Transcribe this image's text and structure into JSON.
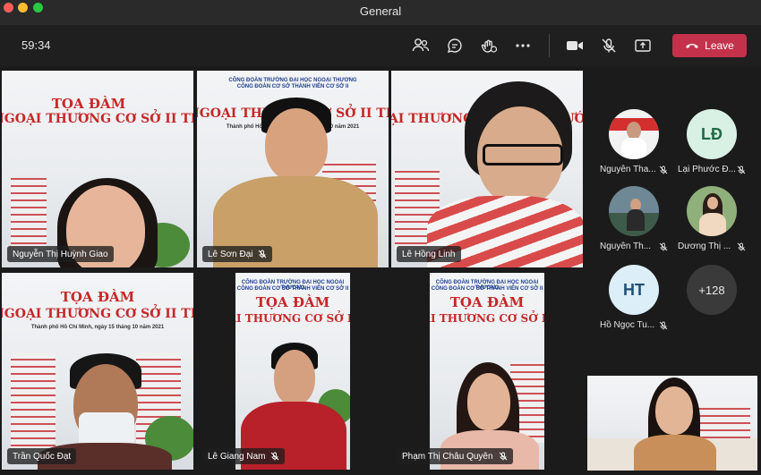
{
  "window": {
    "title": "General"
  },
  "toolbar": {
    "timer": "59:34",
    "leave_label": "Leave",
    "icons": [
      "people-icon",
      "chat-icon",
      "reactions-icon",
      "more-icon",
      "camera-icon",
      "mic-off-icon",
      "share-icon",
      "phone-icon"
    ]
  },
  "banner": {
    "line1": "CÔNG ĐOÀN TRƯỜNG ĐẠI HỌC NGOẠI THƯƠNG",
    "line2": "CÔNG ĐOÀN CƠ SỞ THÀNH VIÊN CƠ SỞ II",
    "title": "TỌA ĐÀM",
    "main": "NGOẠI THƯƠNG CƠ SỞ II TRƯỚC THỀM",
    "date": "Thành phố Hồ Chí Minh, ngày 15 tháng 10 năm 2021"
  },
  "participants": [
    {
      "name": "Nguyễn Thị Huỳnh Giao",
      "muted": false
    },
    {
      "name": "Lê Sơn Đại",
      "muted": true
    },
    {
      "name": "Lê Hồng Linh",
      "muted": false
    },
    {
      "name": "Trần Quốc Đạt",
      "muted": false
    },
    {
      "name": "Lê Giang Nam",
      "muted": true
    },
    {
      "name": "Phạm Thị Châu Quyên",
      "muted": true
    }
  ],
  "roster": [
    {
      "name": "Nguyễn Tha...",
      "initials": ""
    },
    {
      "name": "Lại Phước Đ...",
      "initials": "LĐ"
    },
    {
      "name": "Nguyễn Th...",
      "initials": ""
    },
    {
      "name": "Dương Thị ...",
      "initials": ""
    },
    {
      "name": "Hồ Ngọc Tu...",
      "initials": "HT"
    },
    {
      "name": "",
      "initials": "+128"
    }
  ],
  "colors": {
    "leave": "#c4314b",
    "banner_red": "#c62828",
    "banner_blue": "#1d3f8f"
  }
}
